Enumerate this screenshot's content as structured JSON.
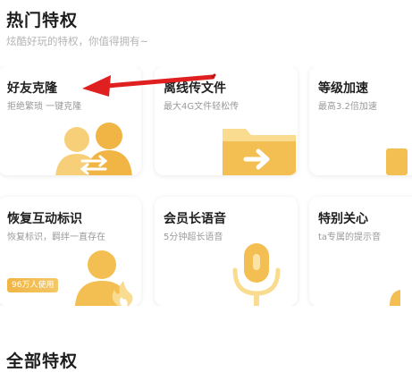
{
  "section": {
    "title": "热门特权",
    "subtitle": "炫酷好玩的特权，你值得拥有~",
    "footer_title": "全部特权"
  },
  "cards": [
    {
      "title": "好友克隆",
      "desc": "拒绝繁琐 一键克隆",
      "icon": "two-people-swap-icon"
    },
    {
      "title": "离线传文件",
      "desc": "最大4G文件轻松传",
      "icon": "folder-arrow-icon"
    },
    {
      "title": "等级加速",
      "desc": "最高3.2倍加速",
      "icon": "speed-icon"
    },
    {
      "title": "恢复互动标识",
      "desc": "恢复标识，羁绊一直存在",
      "icon": "person-flame-icon",
      "badge": "96万人使用"
    },
    {
      "title": "会员长语音",
      "desc": "5分钟超长语音",
      "icon": "microphone-icon"
    },
    {
      "title": "特别关心",
      "desc": "ta专属的提示音",
      "icon": "bell-icon"
    }
  ],
  "colors": {
    "accent": "#f3bf52",
    "accent_light": "#f9dc8f",
    "annotation_arrow": "#e02020"
  }
}
